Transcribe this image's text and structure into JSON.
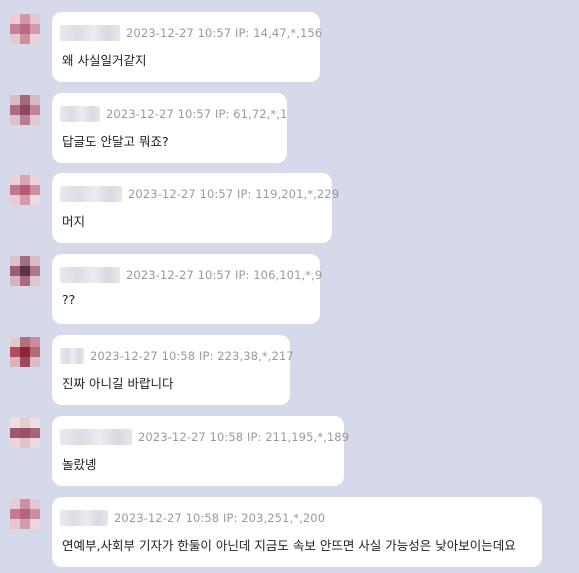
{
  "colors": {
    "background": "#d5d9ea",
    "bubble": "#ffffff",
    "meta_text": "#9a9a9a",
    "message_text": "#222222"
  },
  "icons": {
    "avatar": "pixelated-profile-avatar",
    "nickname": "blurred-nickname"
  },
  "comments": [
    {
      "meta": "2023-12-27 10:57 IP: 14,47,*,156",
      "text": "왜 사실일거같지"
    },
    {
      "meta": "2023-12-27 10:57 IP: 61,72,*,1",
      "text": "답글도 안달고 뭐죠?"
    },
    {
      "meta": "2023-12-27 10:57 IP: 119,201,*,229",
      "text": "머지"
    },
    {
      "meta": "2023-12-27 10:57 IP: 106,101,*,9",
      "text": "??"
    },
    {
      "meta": "2023-12-27 10:58 IP: 223,38,*,217",
      "text": "진짜 아니길 바랍니다"
    },
    {
      "meta": "2023-12-27 10:58 IP: 211,195,*,189",
      "text": "놀랐녱"
    },
    {
      "meta": "2023-12-27 10:58 IP: 203,251,*,200",
      "text": "연예부,사회부 기자가 한둘이 아닌데 지금도 속보 안뜨면 사실 가능성은 낮아보이는데요"
    }
  ]
}
